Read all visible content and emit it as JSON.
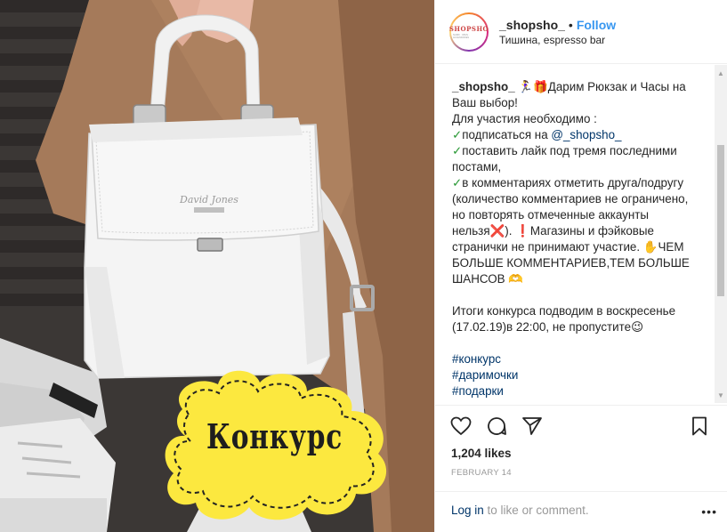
{
  "media": {
    "sticker_text": "Конкурс"
  },
  "header": {
    "avatar_logo": "SHOPSHO",
    "avatar_sub": "SUMKI · OBUV · ACCESSORIES",
    "username": "_shopsho_",
    "separator": "•",
    "follow": "Follow",
    "location": "Тишина, espresso bar"
  },
  "caption": {
    "user": "_shopsho_",
    "l1": " 🏃‍♀️🎁Дарим Рюкзак и Часы на Ваш выбор!",
    "l2": "Для участия необходимо :",
    "check": "✓",
    "c1_text": "подписаться на ",
    "c1_link": "@_shopsho_",
    "c2_text": "поставить лайк под тремя последними постами,",
    "c3_text": "в комментариях отметить друга/подругу (количество комментариев не ограничено, но повторять отмеченные аккаунты нельзя❌). ❗Магазины и фэйковые странички не принимают участие. ✋ЧЕМ БОЛЬШЕ КОММЕНТАРИЕВ,ТЕМ БОЛЬШЕ ШАНСОВ 🫶",
    "l4": "Итоги конкурса подводим в воскресенье (17.02.19)в 22:00, не пропустите😉",
    "tags": [
      "#конкурс",
      "#даримочки",
      "#подарки"
    ]
  },
  "scroll": {
    "up": "▲",
    "down": "▼"
  },
  "actions": {
    "like_icon": "heart-icon",
    "comment_icon": "comment-icon",
    "share_icon": "share-icon",
    "save_icon": "bookmark-icon"
  },
  "likes": "1,204 likes",
  "date": "FEBRUARY 14",
  "footer": {
    "login_link": "Log in",
    "login_rest": " to like or comment.",
    "more": "•••"
  }
}
